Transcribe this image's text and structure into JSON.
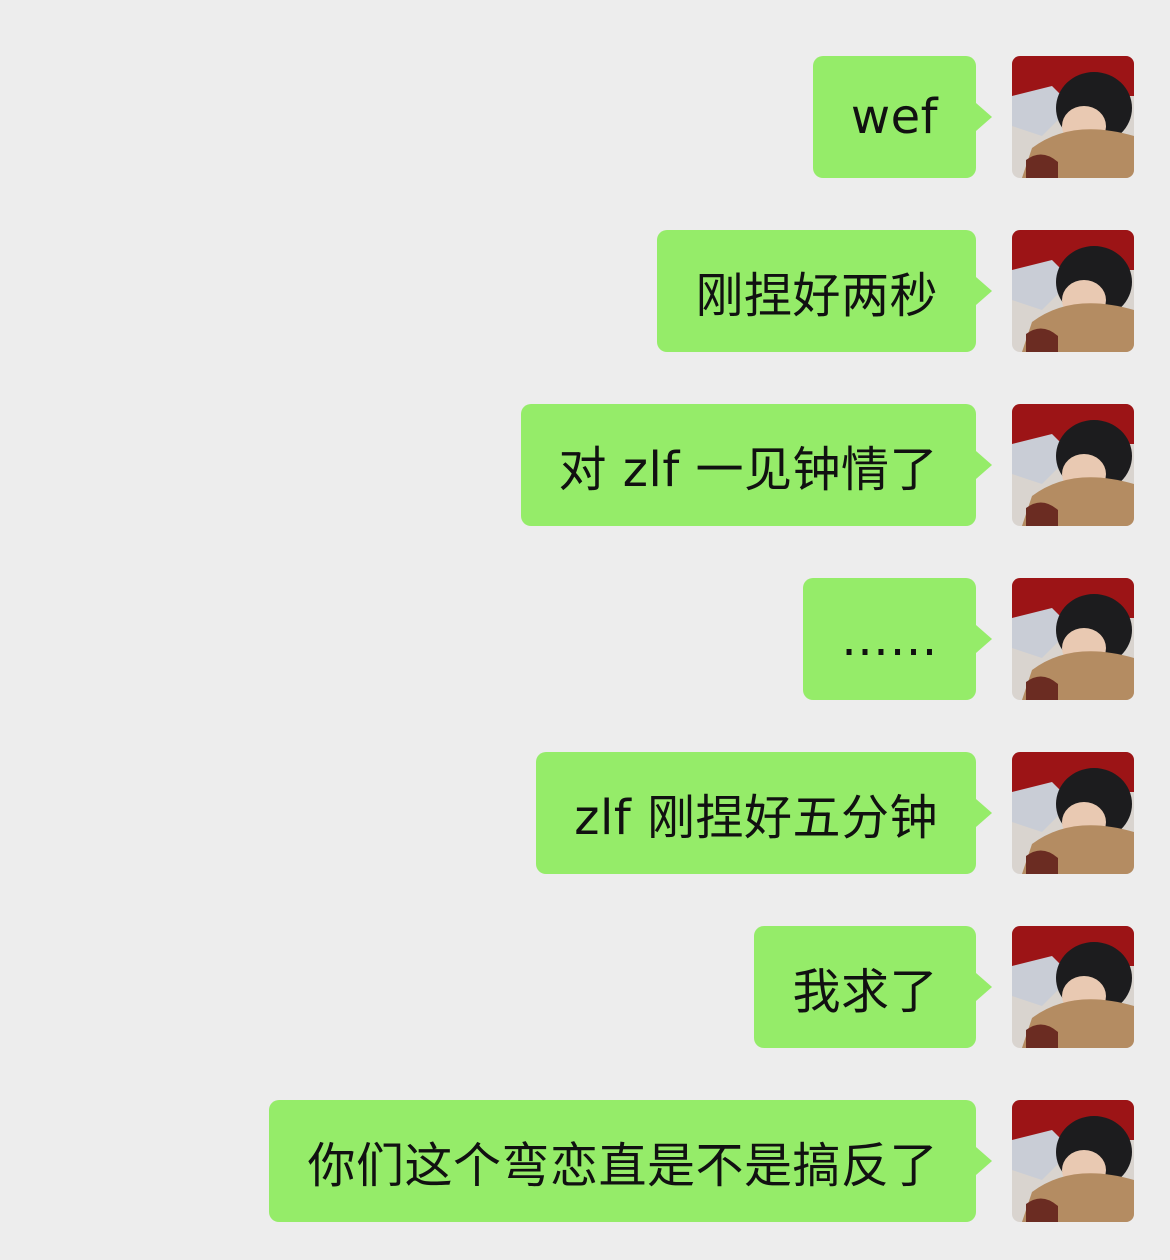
{
  "chat": {
    "messages": [
      {
        "sender": "me",
        "text": "wef"
      },
      {
        "sender": "me",
        "text": "刚捏好两秒"
      },
      {
        "sender": "me",
        "text": "对 zlf 一见钟情了"
      },
      {
        "sender": "me",
        "text": "……"
      },
      {
        "sender": "me",
        "text": "zlf 刚捏好五分钟"
      },
      {
        "sender": "me",
        "text": "我求了"
      },
      {
        "sender": "me",
        "text": "你们这个弯恋直是不是搞反了"
      }
    ]
  },
  "colors": {
    "background": "#ededed",
    "bubble": "#95ec69",
    "text": "#111111"
  },
  "icons": {
    "avatar": "user-avatar-photo"
  }
}
